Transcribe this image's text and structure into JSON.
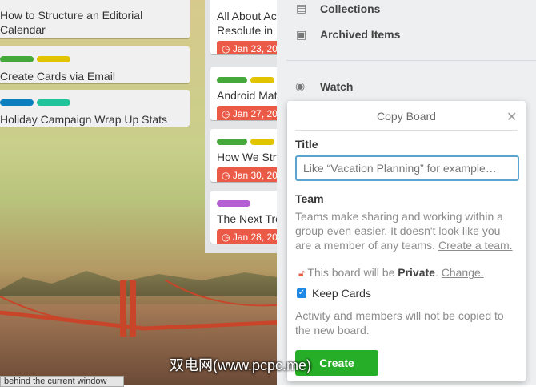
{
  "left_cards": [
    {
      "lines": [
        "How to Structure an Editorial",
        "Calendar"
      ]
    },
    {
      "text": "Create Cards via Email"
    },
    {
      "text": "Holiday Campaign Wrap Up Stats"
    }
  ],
  "middle_cards": [
    {
      "lines": [
        "All About Ac",
        "Resolute in I"
      ],
      "due": "Jan 23, 20"
    },
    {
      "text": "Android Mat",
      "due": "Jan 27, 20"
    },
    {
      "text": "How We Str",
      "due": "Jan 30, 20"
    },
    {
      "text": "The Next Tre",
      "due": "Jan 28, 20"
    }
  ],
  "menu": {
    "collections": "Collections",
    "archived": "Archived Items",
    "watch": "Watch"
  },
  "copy_board": {
    "title": "Copy Board",
    "title_label": "Title",
    "title_placeholder": "Like “Vacation Planning” for example…",
    "team_label": "Team",
    "team_desc": "Teams make sharing and working within a group even easier. It doesn't look like you are a member of any teams.",
    "create_team_link": "Create a team.",
    "private_prefix": "This board will be",
    "private_word": "Private",
    "change_link": "Change.",
    "keep_cards": "Keep Cards",
    "activity_note": "Activity and members will not be copied to the new board.",
    "create_button": "Create"
  },
  "watermark": "双电网(www.pcpc.me)",
  "tooltip": "behind the current window"
}
